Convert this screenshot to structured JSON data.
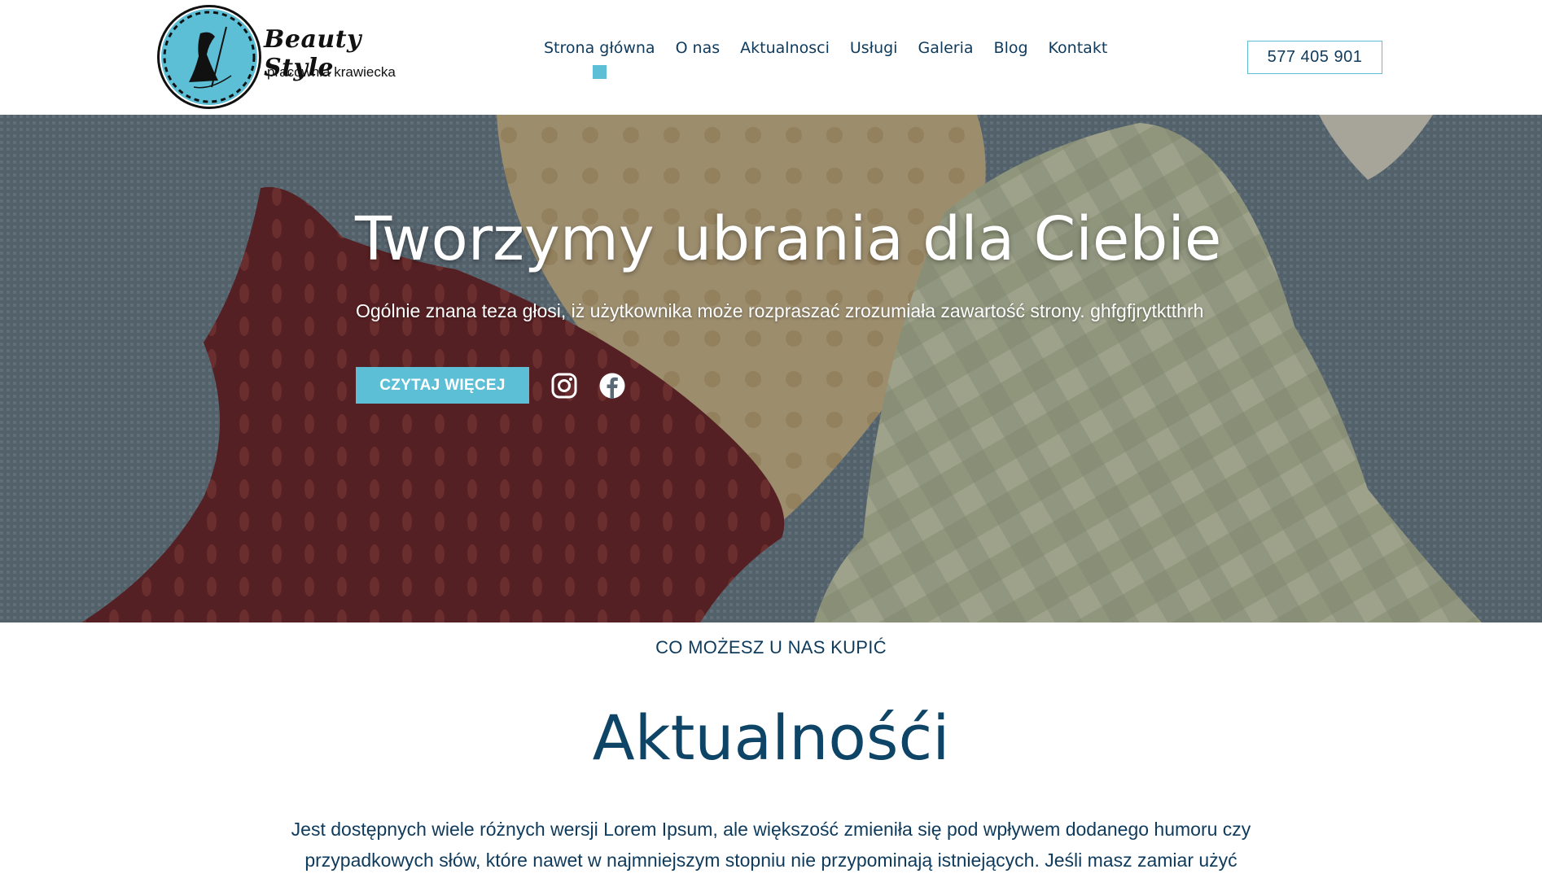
{
  "header": {
    "logo": {
      "title": "Beauty Style",
      "subtitle": "pracownia krawiecka"
    },
    "nav": [
      {
        "label": "Strona główna",
        "active": true
      },
      {
        "label": "O nas",
        "active": false
      },
      {
        "label": "Aktualnosci",
        "active": false
      },
      {
        "label": "Usługi",
        "active": false
      },
      {
        "label": "Galeria",
        "active": false
      },
      {
        "label": "Blog",
        "active": false
      },
      {
        "label": "Kontakt",
        "active": false
      }
    ],
    "phone": "577 405 901"
  },
  "hero": {
    "title": "Tworzymy ubrania dla Ciebie",
    "subtitle": "Ogólnie znana teza głosi, iż użytkownika może rozpraszać zrozumiała zawartość strony. ghfgfjrytktthrh",
    "button_label": "CZYTAJ WIĘCEJ",
    "social": [
      "instagram-icon",
      "facebook-icon"
    ]
  },
  "content": {
    "label": "CO MOŻESZ U NAS KUPIĆ",
    "title": "Aktualnośći",
    "body": "Jest dostępnych wiele różnych wersji Lorem Ipsum, ale większość zmieniła się pod wpływem dodanego humoru czy przypadkowych słów, które nawet w najmniejszym stopniu nie przypominają istniejących. Jeśli masz zamiar użyć"
  },
  "colors": {
    "accent": "#5cbfd6",
    "text": "#0e3a5c"
  }
}
